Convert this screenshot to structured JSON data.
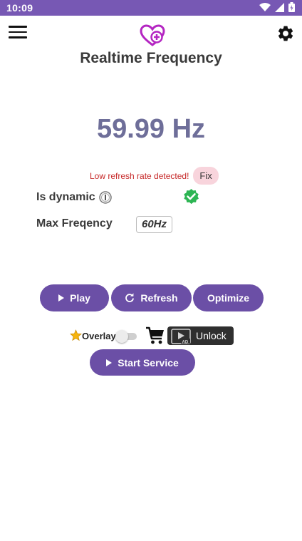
{
  "status": {
    "time": "10:09"
  },
  "app": {
    "title": "Realtime Frequency"
  },
  "display": {
    "frequency": "59.99 Hz"
  },
  "warning": {
    "text": "Low refresh rate detected!",
    "fix_label": "Fix"
  },
  "info": {
    "dynamic_label": "Is dynamic",
    "max_label": "Max Freqency",
    "max_value": "60Hz"
  },
  "buttons": {
    "play": "Play",
    "refresh": "Refresh",
    "optimize": "Optimize",
    "start_service": "Start Service"
  },
  "overlay": {
    "label": "Overlay",
    "enabled": false,
    "unlock_label": "Unlock",
    "ad_badge": "AD"
  },
  "colors": {
    "status_bar": "#7758b4",
    "primary_button": "#6b4fa6",
    "frequency_text": "#6e6e99",
    "warning_text": "#c62828",
    "fix_button": "#f8d4dc",
    "check": "#2db553",
    "logo": "#b426c2"
  },
  "icons": {
    "menu": "hamburger-menu-icon",
    "logo": "heart-plus-logo",
    "settings": "gear-icon",
    "info": "info-icon",
    "check": "verified-check-icon",
    "star": "star-icon",
    "cart": "cart-icon"
  }
}
